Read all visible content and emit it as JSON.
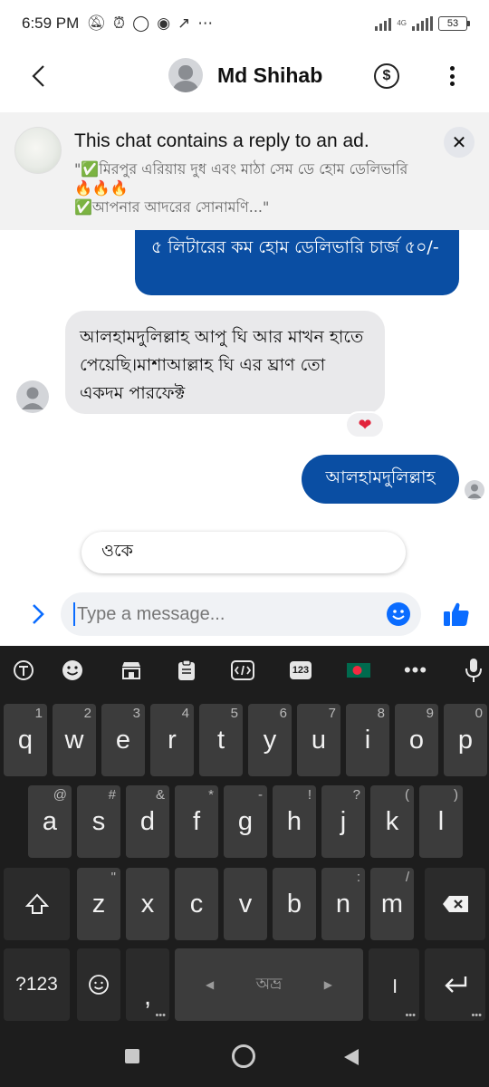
{
  "status_bar": {
    "time": "6:59 PM",
    "network": "4G",
    "battery": "53"
  },
  "header": {
    "contact_name": "Md Shihab"
  },
  "ad_banner": {
    "title": "This chat contains a reply to an ad.",
    "line1": "\"✅মিরপুর এরিয়ায় দুধ এবং মাঠা সেম ডে হোম ডেলিভারি",
    "line2": "🔥🔥🔥",
    "line3": "✅আপনার আদরের সোনামণি...\""
  },
  "messages": {
    "outgoing_1": "৫ লিটারের কম হোম ডেলিভারি চার্জ ৫০/-",
    "incoming_1": "আলহামদুলিল্লাহ আপু ঘি আর মাখন হাতে পেয়েছি।মাশাআল্লাহ ঘি এর ঘ্রাণ তো একদম পারফেক্ট",
    "reaction": "❤",
    "outgoing_2": "আলহামদুলিল্লাহ"
  },
  "suggestion": {
    "text": "ওকে"
  },
  "composer": {
    "placeholder": "Type a message..."
  },
  "keyboard": {
    "toolbar_badge": "123",
    "row1": [
      {
        "k": "q",
        "h": "1"
      },
      {
        "k": "w",
        "h": "2"
      },
      {
        "k": "e",
        "h": "3"
      },
      {
        "k": "r",
        "h": "4"
      },
      {
        "k": "t",
        "h": "5"
      },
      {
        "k": "y",
        "h": "6"
      },
      {
        "k": "u",
        "h": "7"
      },
      {
        "k": "i",
        "h": "8"
      },
      {
        "k": "o",
        "h": "9"
      },
      {
        "k": "p",
        "h": "0"
      }
    ],
    "row2": [
      {
        "k": "a",
        "h": "@"
      },
      {
        "k": "s",
        "h": "#"
      },
      {
        "k": "d",
        "h": "&"
      },
      {
        "k": "f",
        "h": "*"
      },
      {
        "k": "g",
        "h": "-"
      },
      {
        "k": "h",
        "h": "!"
      },
      {
        "k": "j",
        "h": "?"
      },
      {
        "k": "k",
        "h": "("
      },
      {
        "k": "l",
        "h": ")"
      }
    ],
    "row3": [
      {
        "k": "z",
        "h": "\""
      },
      {
        "k": "x",
        "h": ""
      },
      {
        "k": "c",
        "h": ""
      },
      {
        "k": "v",
        "h": ""
      },
      {
        "k": "b",
        "h": ""
      },
      {
        "k": "n",
        "h": ":"
      },
      {
        "k": "m",
        "h": "/"
      }
    ],
    "symbols_key": "?123",
    "comma_key": ",",
    "space_label": "অভ্র",
    "period_key": "।"
  },
  "colors": {
    "accent": "#0a4ea3",
    "messenger_blue": "#0a6cff",
    "keyboard_bg": "#1d1d1d",
    "key_bg": "#3c3c3c"
  }
}
